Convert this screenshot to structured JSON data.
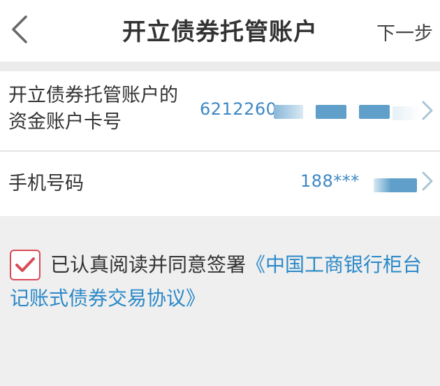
{
  "header": {
    "title": "开立债券托管账户",
    "next_label": "下一步",
    "back_icon": "chevron-left-icon"
  },
  "card_row": {
    "label": "开立债券托管账户的资金账户卡号",
    "value": "6212260"
  },
  "phone_row": {
    "label": "手机号码",
    "value": "188***"
  },
  "agreement": {
    "checked": true,
    "text": "已认真阅读并同意签署",
    "link": "《中国工商银行柜台记账式债券交易协议》"
  },
  "colors": {
    "accent": "#3d88c5",
    "link": "#2b89c8",
    "check": "#d94a56",
    "background": "#f0f0f0"
  }
}
